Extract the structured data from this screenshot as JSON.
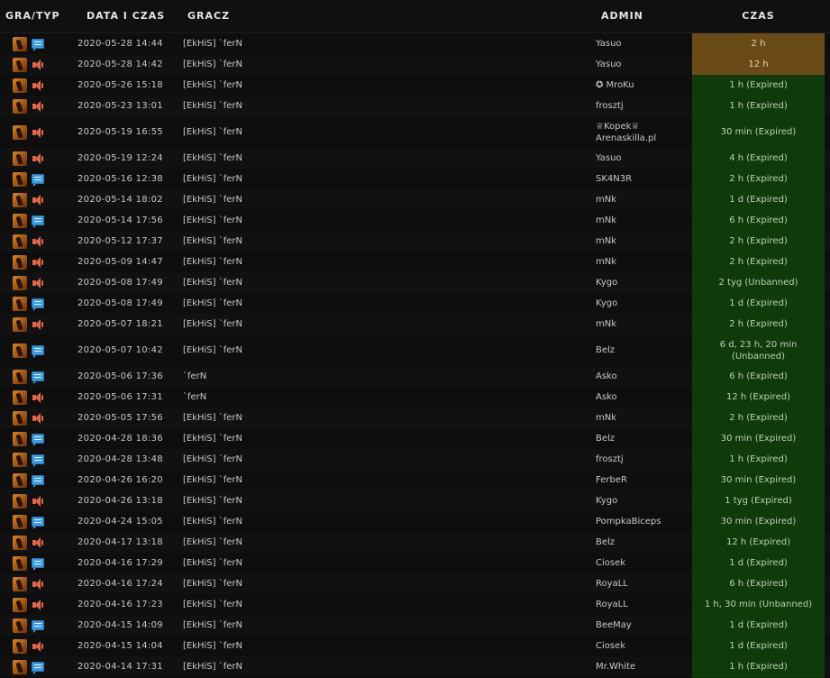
{
  "header": {
    "game_type": "GRA/TYP",
    "date_time": "DATA I CZAS",
    "player": "GRACZ",
    "admin": "ADMIN",
    "time": "CZAS"
  },
  "colors": {
    "active_ban": "#6a4a17",
    "expired_ban": "#0f3a0a",
    "chat_icon": "#3f9be0",
    "voice_icon": "#e0674a"
  },
  "rows": [
    {
      "type": "chat-icon",
      "date": "2020-05-28 14:44",
      "player": "[EkHiS] `ferN",
      "admin": "Yasuo",
      "time": "2 h",
      "active": true
    },
    {
      "type": "speaker-icon",
      "date": "2020-05-28 14:42",
      "player": "[EkHiS] `ferN",
      "admin": "Yasuo",
      "time": "12 h",
      "active": true
    },
    {
      "type": "speaker-icon",
      "date": "2020-05-26 15:18",
      "player": "[EkHiS] `ferN",
      "admin": "✪ MroKu",
      "time": "1 h (Expired)"
    },
    {
      "type": "speaker-icon",
      "date": "2020-05-23 13:01",
      "player": "[EkHiS] `ferN",
      "admin": "frosztj",
      "time": "1 h (Expired)"
    },
    {
      "type": "speaker-icon",
      "date": "2020-05-19 16:55",
      "player": "[EkHiS] `ferN",
      "admin": "♕Kopek♕\nArenaskilla.pl",
      "time": "30 min (Expired)",
      "tall": true
    },
    {
      "type": "speaker-icon",
      "date": "2020-05-19 12:24",
      "player": "[EkHiS] `ferN",
      "admin": "Yasuo",
      "time": "4 h (Expired)"
    },
    {
      "type": "chat-icon",
      "date": "2020-05-16 12:38",
      "player": "[EkHiS] `ferN",
      "admin": "SK4N3R",
      "time": "2 h (Expired)"
    },
    {
      "type": "speaker-icon",
      "date": "2020-05-14 18:02",
      "player": "[EkHiS] `ferN",
      "admin": "mNk",
      "time": "1 d (Expired)"
    },
    {
      "type": "chat-icon",
      "date": "2020-05-14 17:56",
      "player": "[EkHiS] `ferN",
      "admin": "mNk",
      "time": "6 h (Expired)"
    },
    {
      "type": "speaker-icon",
      "date": "2020-05-12 17:37",
      "player": "[EkHiS] `ferN",
      "admin": "mNk",
      "time": "2 h (Expired)"
    },
    {
      "type": "speaker-icon",
      "date": "2020-05-09 14:47",
      "player": "[EkHiS] `ferN",
      "admin": "mNk",
      "time": "2 h (Expired)"
    },
    {
      "type": "speaker-icon",
      "date": "2020-05-08 17:49",
      "player": "[EkHiS] `ferN",
      "admin": "Kygo",
      "time": "2 tyg (Unbanned)"
    },
    {
      "type": "chat-icon",
      "date": "2020-05-08 17:49",
      "player": "[EkHiS] `ferN",
      "admin": "Kygo",
      "time": "1 d (Expired)"
    },
    {
      "type": "speaker-icon",
      "date": "2020-05-07 18:21",
      "player": "[EkHiS] `ferN",
      "admin": "mNk",
      "time": "2 h (Expired)"
    },
    {
      "type": "chat-icon",
      "date": "2020-05-07 10:42",
      "player": "[EkHiS] `ferN",
      "admin": "Belz",
      "time": "6 d, 23 h, 20 min\n(Unbanned)",
      "tall": true
    },
    {
      "type": "chat-icon",
      "date": "2020-05-06 17:36",
      "player": "`ferN",
      "admin": "Asko",
      "time": "6 h (Expired)"
    },
    {
      "type": "speaker-icon",
      "date": "2020-05-06 17:31",
      "player": "`ferN",
      "admin": "Asko",
      "time": "12 h (Expired)"
    },
    {
      "type": "speaker-icon",
      "date": "2020-05-05 17:56",
      "player": "[EkHiS] `ferN",
      "admin": "mNk",
      "time": "2 h (Expired)"
    },
    {
      "type": "chat-icon",
      "date": "2020-04-28 18:36",
      "player": "[EkHiS] `ferN",
      "admin": "Belz",
      "time": "30 min (Expired)"
    },
    {
      "type": "chat-icon",
      "date": "2020-04-28 13:48",
      "player": "[EkHiS] `ferN",
      "admin": "frosztj",
      "time": "1 h (Expired)"
    },
    {
      "type": "chat-icon",
      "date": "2020-04-26 16:20",
      "player": "[EkHiS] `ferN",
      "admin": "FerbeR",
      "time": "30 min (Expired)"
    },
    {
      "type": "speaker-icon",
      "date": "2020-04-26 13:18",
      "player": "[EkHiS] `ferN",
      "admin": "Kygo",
      "time": "1 tyg (Expired)"
    },
    {
      "type": "chat-icon",
      "date": "2020-04-24 15:05",
      "player": "[EkHiS] `ferN",
      "admin": "PompkaBiceps",
      "time": "30 min (Expired)"
    },
    {
      "type": "speaker-icon",
      "date": "2020-04-17 13:18",
      "player": "[EkHiS] `ferN",
      "admin": "Belz",
      "time": "12 h (Expired)"
    },
    {
      "type": "chat-icon",
      "date": "2020-04-16 17:29",
      "player": "[EkHiS] `ferN",
      "admin": "Ciosek",
      "time": "1 d (Expired)"
    },
    {
      "type": "speaker-icon",
      "date": "2020-04-16 17:24",
      "player": "[EkHiS] `ferN",
      "admin": "RoyaLL",
      "time": "6 h (Expired)"
    },
    {
      "type": "speaker-icon",
      "date": "2020-04-16 17:23",
      "player": "[EkHiS] `ferN",
      "admin": "RoyaLL",
      "time": "1 h, 30 min (Unbanned)"
    },
    {
      "type": "chat-icon",
      "date": "2020-04-15 14:09",
      "player": "[EkHiS] `ferN",
      "admin": "BeeMay",
      "time": "1 d (Expired)"
    },
    {
      "type": "speaker-icon",
      "date": "2020-04-15 14:04",
      "player": "[EkHiS] `ferN",
      "admin": "Ciosek",
      "time": "1 d (Expired)"
    },
    {
      "type": "chat-icon",
      "date": "2020-04-14 17:31",
      "player": "[EkHiS] `ferN",
      "admin": "Mr.White",
      "time": "1 h (Expired)"
    }
  ]
}
